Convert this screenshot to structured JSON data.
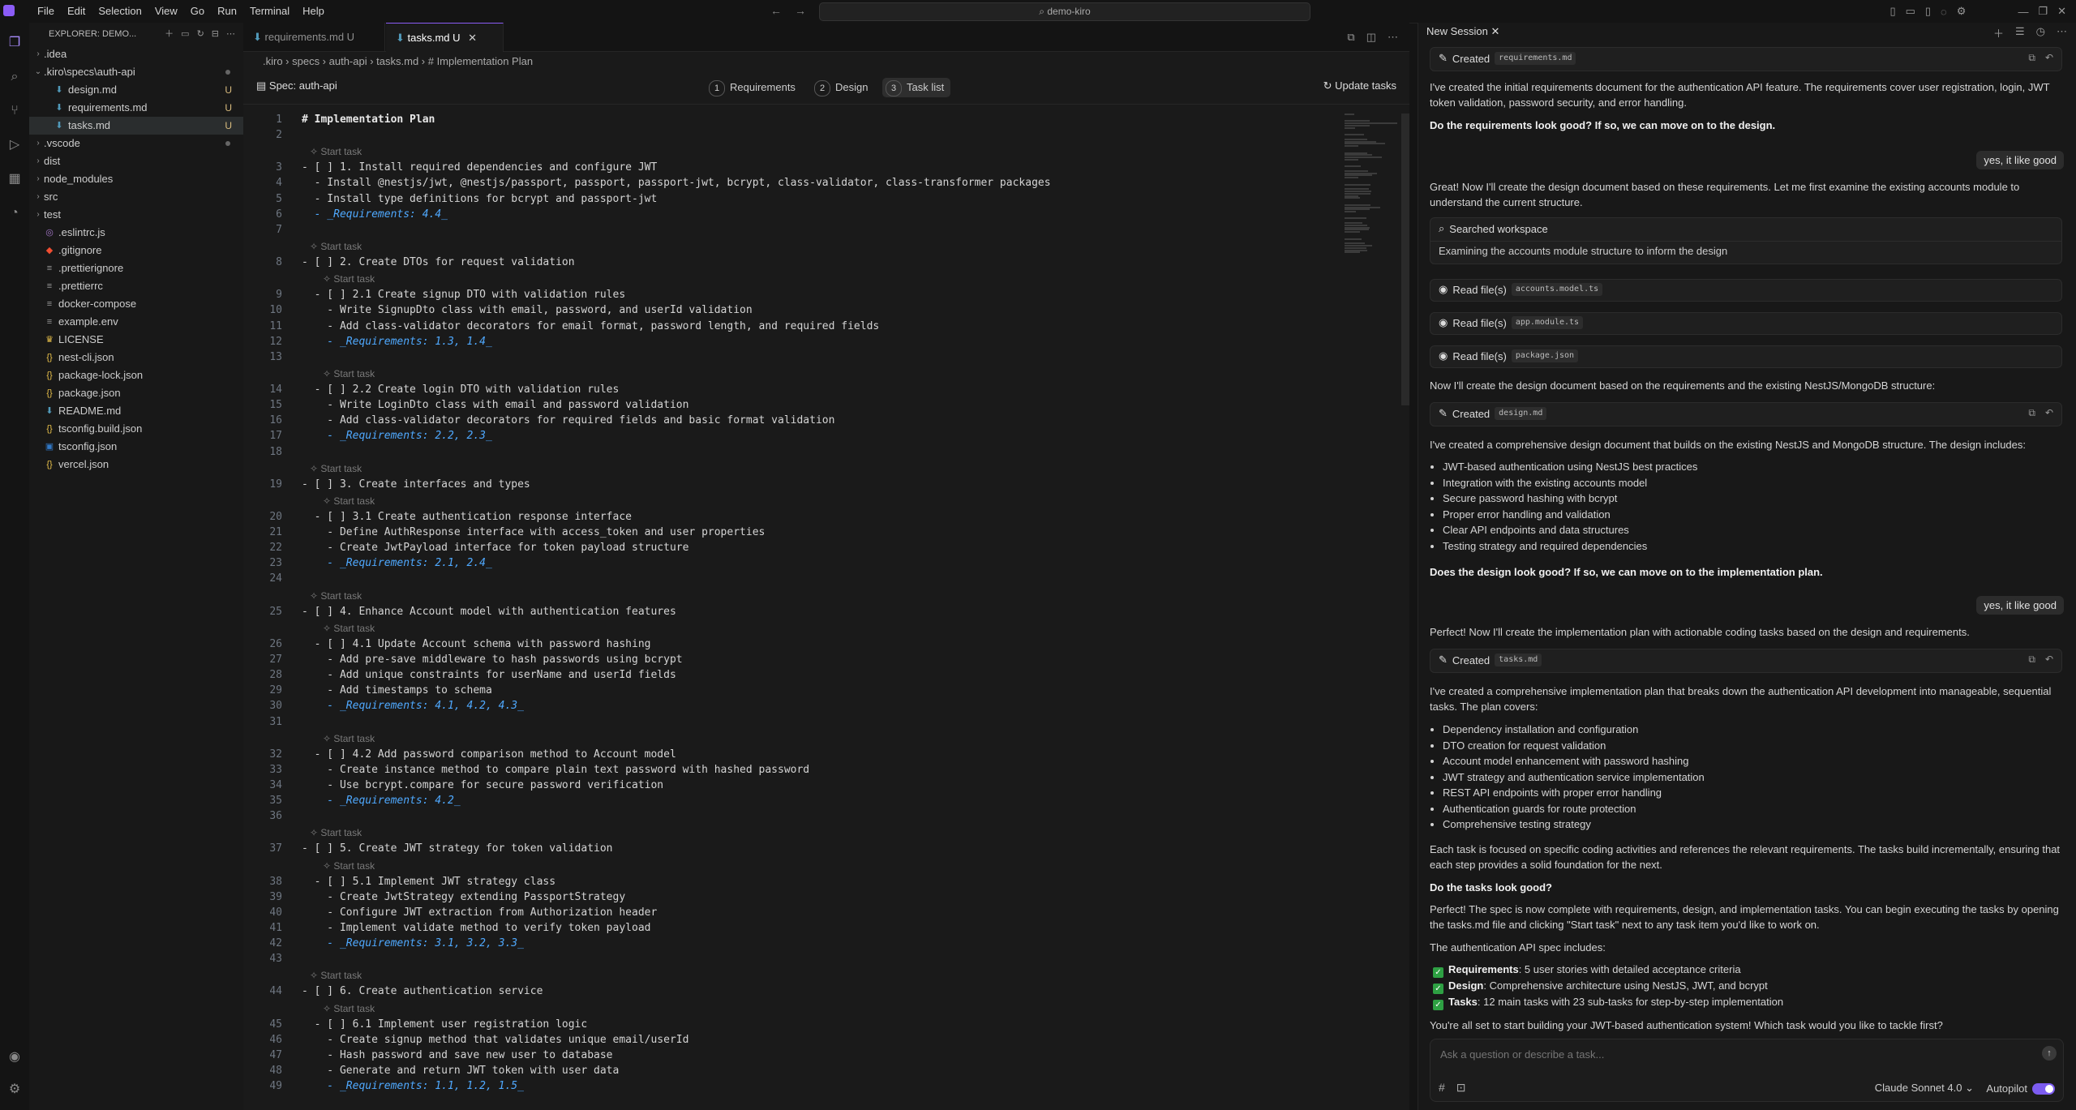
{
  "titlebar": {
    "menu": [
      "File",
      "Edit",
      "Selection",
      "View",
      "Go",
      "Run",
      "Terminal",
      "Help"
    ],
    "search": "demo-kiro"
  },
  "sidebar": {
    "title": "EXPLORER: DEMO...",
    "items": [
      {
        "label": ".idea",
        "kind": "folder",
        "indent": 0,
        "status": ""
      },
      {
        "label": ".kiro\\specs\\auth-api",
        "kind": "folder-open",
        "indent": 0,
        "status": "dot"
      },
      {
        "label": "design.md",
        "kind": "md",
        "indent": 1,
        "status": "U"
      },
      {
        "label": "requirements.md",
        "kind": "md",
        "indent": 1,
        "status": "U"
      },
      {
        "label": "tasks.md",
        "kind": "md",
        "indent": 1,
        "status": "U"
      },
      {
        "label": ".vscode",
        "kind": "folder",
        "indent": 0,
        "status": "dot"
      },
      {
        "label": "dist",
        "kind": "folder",
        "indent": 0,
        "status": ""
      },
      {
        "label": "node_modules",
        "kind": "folder",
        "indent": 0,
        "status": ""
      },
      {
        "label": "src",
        "kind": "folder",
        "indent": 0,
        "status": ""
      },
      {
        "label": "test",
        "kind": "folder",
        "indent": 0,
        "status": ""
      },
      {
        "label": ".eslintrc.js",
        "kind": "js",
        "indent": 0,
        "status": ""
      },
      {
        "label": ".gitignore",
        "kind": "git",
        "indent": 0,
        "status": ""
      },
      {
        "label": ".prettierignore",
        "kind": "cfg",
        "indent": 0,
        "status": ""
      },
      {
        "label": ".prettierrc",
        "kind": "cfg",
        "indent": 0,
        "status": ""
      },
      {
        "label": "docker-compose",
        "kind": "cfg",
        "indent": 0,
        "status": ""
      },
      {
        "label": "example.env",
        "kind": "cfg",
        "indent": 0,
        "status": ""
      },
      {
        "label": "LICENSE",
        "kind": "lic",
        "indent": 0,
        "status": ""
      },
      {
        "label": "nest-cli.json",
        "kind": "json",
        "indent": 0,
        "status": ""
      },
      {
        "label": "package-lock.json",
        "kind": "json",
        "indent": 0,
        "status": ""
      },
      {
        "label": "package.json",
        "kind": "json",
        "indent": 0,
        "status": ""
      },
      {
        "label": "README.md",
        "kind": "md",
        "indent": 0,
        "status": ""
      },
      {
        "label": "tsconfig.build.json",
        "kind": "json",
        "indent": 0,
        "status": ""
      },
      {
        "label": "tsconfig.json",
        "kind": "ts",
        "indent": 0,
        "status": ""
      },
      {
        "label": "vercel.json",
        "kind": "json",
        "indent": 0,
        "status": ""
      }
    ]
  },
  "editor": {
    "tabs": [
      {
        "label": "requirements.md U",
        "active": false
      },
      {
        "label": "tasks.md U",
        "active": true
      }
    ],
    "breadcrumb": ".kiro › specs › auth-api › tasks.md › # Implementation Plan",
    "spec_title": "Spec: auth-api",
    "steps": [
      {
        "num": "1",
        "label": "Requirements"
      },
      {
        "num": "2",
        "label": "Design"
      },
      {
        "num": "3",
        "label": "Task list"
      }
    ],
    "update_label": "Update tasks",
    "codelens": "Start task",
    "lines": [
      {
        "n": 1,
        "t": "# Implementation Plan",
        "c": "h1"
      },
      {
        "n": 2,
        "t": ""
      },
      {
        "n": 3,
        "t": "- [ ] 1. Install required dependencies and configure JWT",
        "lens": 0
      },
      {
        "n": 4,
        "t": "  - Install @nestjs/jwt, @nestjs/passport, passport, passport-jwt, bcrypt, class-validator, class-transformer packages"
      },
      {
        "n": 5,
        "t": "  - Install type definitions for bcrypt and passport-jwt"
      },
      {
        "n": 6,
        "t": "  - _Requirements: 4.4_",
        "c": "req"
      },
      {
        "n": 7,
        "t": ""
      },
      {
        "n": 8,
        "t": "- [ ] 2. Create DTOs for request validation",
        "lens": 0
      },
      {
        "n": 9,
        "t": "  - [ ] 2.1 Create signup DTO with validation rules",
        "lens": 1
      },
      {
        "n": 10,
        "t": "    - Write SignupDto class with email, password, and userId validation"
      },
      {
        "n": 11,
        "t": "    - Add class-validator decorators for email format, password length, and required fields"
      },
      {
        "n": 12,
        "t": "    - _Requirements: 1.3, 1.4_",
        "c": "req"
      },
      {
        "n": 13,
        "t": ""
      },
      {
        "n": 14,
        "t": "  - [ ] 2.2 Create login DTO with validation rules",
        "lens": 1
      },
      {
        "n": 15,
        "t": "    - Write LoginDto class with email and password validation"
      },
      {
        "n": 16,
        "t": "    - Add class-validator decorators for required fields and basic format validation"
      },
      {
        "n": 17,
        "t": "    - _Requirements: 2.2, 2.3_",
        "c": "req"
      },
      {
        "n": 18,
        "t": ""
      },
      {
        "n": 19,
        "t": "- [ ] 3. Create interfaces and types",
        "lens": 0
      },
      {
        "n": 20,
        "t": "  - [ ] 3.1 Create authentication response interface",
        "lens": 1
      },
      {
        "n": 21,
        "t": "    - Define AuthResponse interface with access_token and user properties"
      },
      {
        "n": 22,
        "t": "    - Create JwtPayload interface for token payload structure"
      },
      {
        "n": 23,
        "t": "    - _Requirements: 2.1, 2.4_",
        "c": "req"
      },
      {
        "n": 24,
        "t": ""
      },
      {
        "n": 25,
        "t": "- [ ] 4. Enhance Account model with authentication features",
        "lens": 0
      },
      {
        "n": 26,
        "t": "  - [ ] 4.1 Update Account schema with password hashing",
        "lens": 1
      },
      {
        "n": 27,
        "t": "    - Add pre-save middleware to hash passwords using bcrypt"
      },
      {
        "n": 28,
        "t": "    - Add unique constraints for userName and userId fields"
      },
      {
        "n": 29,
        "t": "    - Add timestamps to schema"
      },
      {
        "n": 30,
        "t": "    - _Requirements: 4.1, 4.2, 4.3_",
        "c": "req"
      },
      {
        "n": 31,
        "t": ""
      },
      {
        "n": 32,
        "t": "  - [ ] 4.2 Add password comparison method to Account model",
        "lens": 1
      },
      {
        "n": 33,
        "t": "    - Create instance method to compare plain text password with hashed password"
      },
      {
        "n": 34,
        "t": "    - Use bcrypt.compare for secure password verification"
      },
      {
        "n": 35,
        "t": "    - _Requirements: 4.2_",
        "c": "req"
      },
      {
        "n": 36,
        "t": ""
      },
      {
        "n": 37,
        "t": "- [ ] 5. Create JWT strategy for token validation",
        "lens": 0
      },
      {
        "n": 38,
        "t": "  - [ ] 5.1 Implement JWT strategy class",
        "lens": 1
      },
      {
        "n": 39,
        "t": "    - Create JwtStrategy extending PassportStrategy"
      },
      {
        "n": 40,
        "t": "    - Configure JWT extraction from Authorization header"
      },
      {
        "n": 41,
        "t": "    - Implement validate method to verify token payload"
      },
      {
        "n": 42,
        "t": "    - _Requirements: 3.1, 3.2, 3.3_",
        "c": "req"
      },
      {
        "n": 43,
        "t": ""
      },
      {
        "n": 44,
        "t": "- [ ] 6. Create authentication service",
        "lens": 0
      },
      {
        "n": 45,
        "t": "  - [ ] 6.1 Implement user registration logic",
        "lens": 1
      },
      {
        "n": 46,
        "t": "    - Create signup method that validates unique email/userId"
      },
      {
        "n": 47,
        "t": "    - Hash password and save new user to database"
      },
      {
        "n": 48,
        "t": "    - Generate and return JWT token with user data"
      },
      {
        "n": 49,
        "t": "    - _Requirements: 1.1, 1.2, 1.5_",
        "c": "req"
      }
    ]
  },
  "chat": {
    "tab_label": "New Session",
    "created_label": "Created",
    "read_label": "Read file(s)",
    "searched_label": "Searched workspace",
    "searched_detail": "Examining the accounts module structure to inform the design",
    "files": {
      "requirements": "requirements.md",
      "design": "design.md",
      "tasks": "tasks.md",
      "accounts_model": "accounts.model.ts",
      "app_module": "app.module.ts",
      "package_json": "package.json"
    },
    "m1": "I've created the initial requirements document for the authentication API feature. The requirements cover user registration, login, JWT token validation, password security, and error handling.",
    "m1q": "Do the requirements look good? If so, we can move on to the design.",
    "u1": "yes, it like good",
    "m2": "Great! Now I'll create the design document based on these requirements. Let me first examine the existing accounts module to understand the current structure.",
    "m3": "Now I'll create the design document based on the requirements and the existing NestJS/MongoDB structure:",
    "m4": "I've created a comprehensive design document that builds on the existing NestJS and MongoDB structure. The design includes:",
    "design_list": [
      "JWT-based authentication using NestJS best practices",
      "Integration with the existing accounts model",
      "Secure password hashing with bcrypt",
      "Proper error handling and validation",
      "Clear API endpoints and data structures",
      "Testing strategy and required dependencies"
    ],
    "m4q": "Does the design look good? If so, we can move on to the implementation plan.",
    "u2": "yes, it like good",
    "m5": "Perfect! Now I'll create the implementation plan with actionable coding tasks based on the design and requirements.",
    "m6": "I've created a comprehensive implementation plan that breaks down the authentication API development into manageable, sequential tasks. The plan covers:",
    "plan_list": [
      "Dependency installation and configuration",
      "DTO creation for request validation",
      "Account model enhancement with password hashing",
      "JWT strategy and authentication service implementation",
      "REST API endpoints with proper error handling",
      "Authentication guards for route protection",
      "Comprehensive testing strategy"
    ],
    "m7": "Each task is focused on specific coding activities and references the relevant requirements. The tasks build incrementally, ensuring that each step provides a solid foundation for the next.",
    "m7q": "Do the tasks look good?",
    "m8": "Perfect! The spec is now complete with requirements, design, and implementation tasks. You can begin executing the tasks by opening the tasks.md file and clicking \"Start task\" next to any task item you'd like to work on.",
    "m9": "The authentication API spec includes:",
    "spec_list": [
      {
        "label": "Requirements",
        "text": ": 5 user stories with detailed acceptance criteria"
      },
      {
        "label": "Design",
        "text": ": Comprehensive architecture using NestJS, JWT, and bcrypt"
      },
      {
        "label": "Tasks",
        "text": ": 12 main tasks with 23 sub-tasks for step-by-step implementation"
      }
    ],
    "m10": "You're all set to start building your JWT-based authentication system! Which task would you like to tackle first?",
    "input_placeholder": "Ask a question or describe a task...",
    "model": "Claude Sonnet 4.0",
    "autopilot": "Autopilot"
  }
}
